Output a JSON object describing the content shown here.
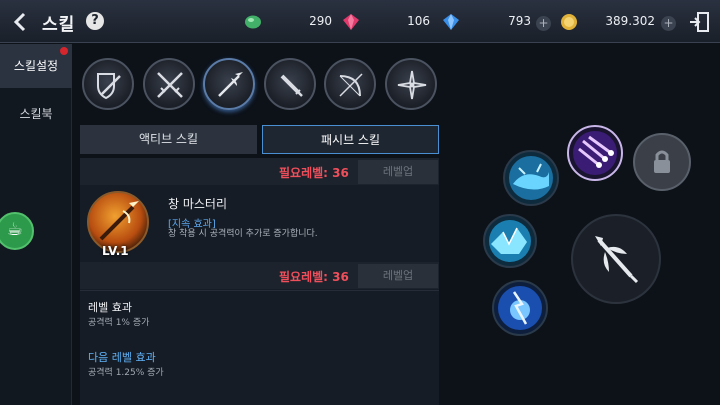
{
  "header": {
    "back_icon": "chevron-left-icon",
    "title": "스킬",
    "help_label": "?"
  },
  "currencies": [
    {
      "name": "green-gem",
      "icon": "green-gem-icon",
      "value": "290",
      "color": "#43b06a"
    },
    {
      "name": "red-gem",
      "icon": "red-gem-icon",
      "value": "106",
      "color": "#e03a6c"
    },
    {
      "name": "blue-gem",
      "icon": "blue-gem-icon",
      "value": "793",
      "color": "#3a8fe8",
      "plus": "+"
    },
    {
      "name": "gold",
      "icon": "gold-coin-icon",
      "value": "389.302",
      "color": "#e0b23a",
      "plus": "+"
    }
  ],
  "nav": {
    "items": [
      {
        "label": "스킬설정",
        "active": true,
        "notification": true
      },
      {
        "label": "스킬북",
        "active": false
      }
    ]
  },
  "weapons": [
    {
      "icon": "shield-sword-icon"
    },
    {
      "icon": "dual-swords-icon"
    },
    {
      "icon": "spear-icon",
      "active": true
    },
    {
      "icon": "dagger-icon"
    },
    {
      "icon": "bow-icon"
    },
    {
      "icon": "shuriken-icon"
    }
  ],
  "tabs": {
    "active_skill": "액티브 스킬",
    "passive_skill": "패시브 스킬"
  },
  "panel": {
    "required_level_1": "필요레벨: 36",
    "levelup_1": "레벨업",
    "skill_name": "창 마스터리",
    "skill_tag": "[지속 효과]",
    "skill_desc": "창 착용 시 공격력이 추가로 증가합니다.",
    "skill_level": "LV.1",
    "required_level_2": "필요레벨: 36",
    "levelup_2": "레벨업",
    "current_effect_title": "레벨 효과",
    "current_effect_value": "공격력 1% 증가",
    "next_effect_title": "다음 레벨 효과",
    "next_effect_value": "공격력 1.25% 증가"
  },
  "skill_graph": {
    "nodes": [
      {
        "icon": "whale-splash-icon"
      },
      {
        "icon": "meteor-purple-icon"
      },
      {
        "icon": "lock-icon"
      },
      {
        "icon": "ice-shards-icon"
      },
      {
        "icon": "lightning-orb-icon"
      },
      {
        "icon": "spear-main-icon"
      }
    ]
  }
}
